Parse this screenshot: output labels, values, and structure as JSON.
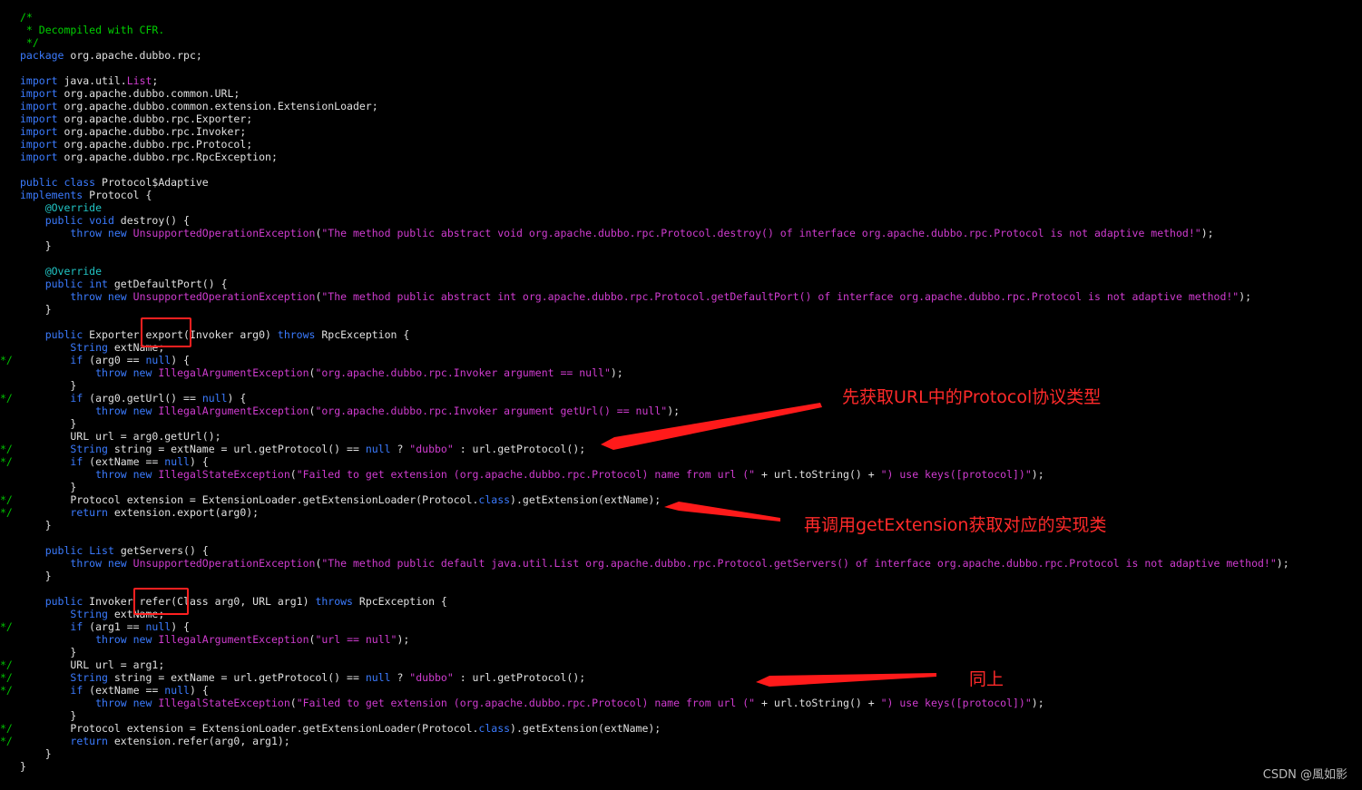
{
  "colors": {
    "background": "#000000",
    "comment": "#00d000",
    "keyword": "#3b7bff",
    "string": "#d03cd0",
    "annotation": "#21c4c4",
    "plain": "#e0e0e0",
    "annotation_red": "#ff2020"
  },
  "code_lines": [
    {
      "g": "",
      "s": [
        [
          "c",
          "/*"
        ]
      ]
    },
    {
      "g": "",
      "s": [
        [
          "c",
          " * Decompiled with CFR."
        ]
      ]
    },
    {
      "g": "",
      "s": [
        [
          "c",
          " */"
        ]
      ]
    },
    {
      "g": "",
      "s": [
        [
          "k",
          "package"
        ],
        [
          "p",
          " org.apache.dubbo.rpc;"
        ]
      ]
    },
    {
      "g": "",
      "s": []
    },
    {
      "g": "",
      "s": [
        [
          "k",
          "import"
        ],
        [
          "p",
          " java.util."
        ],
        [
          "s",
          "List"
        ],
        [
          "p",
          ";"
        ]
      ]
    },
    {
      "g": "",
      "s": [
        [
          "k",
          "import"
        ],
        [
          "p",
          " org.apache.dubbo.common.URL;"
        ]
      ]
    },
    {
      "g": "",
      "s": [
        [
          "k",
          "import"
        ],
        [
          "p",
          " org.apache.dubbo.common.extension.ExtensionLoader;"
        ]
      ]
    },
    {
      "g": "",
      "s": [
        [
          "k",
          "import"
        ],
        [
          "p",
          " org.apache.dubbo.rpc.Exporter;"
        ]
      ]
    },
    {
      "g": "",
      "s": [
        [
          "k",
          "import"
        ],
        [
          "p",
          " org.apache.dubbo.rpc.Invoker;"
        ]
      ]
    },
    {
      "g": "",
      "s": [
        [
          "k",
          "import"
        ],
        [
          "p",
          " org.apache.dubbo.rpc.Protocol;"
        ]
      ]
    },
    {
      "g": "",
      "s": [
        [
          "k",
          "import"
        ],
        [
          "p",
          " org.apache.dubbo.rpc.RpcException;"
        ]
      ]
    },
    {
      "g": "",
      "s": []
    },
    {
      "g": "",
      "s": [
        [
          "k",
          "public class"
        ],
        [
          "p",
          " Protocol$Adaptive"
        ]
      ]
    },
    {
      "g": "",
      "s": [
        [
          "k",
          "implements"
        ],
        [
          "p",
          " Protocol {"
        ]
      ]
    },
    {
      "g": "",
      "s": [
        [
          "p",
          "    "
        ],
        [
          "a",
          "@Override"
        ]
      ]
    },
    {
      "g": "",
      "s": [
        [
          "p",
          "    "
        ],
        [
          "k",
          "public void"
        ],
        [
          "p",
          " destroy() {"
        ]
      ]
    },
    {
      "g": "",
      "s": [
        [
          "p",
          "        "
        ],
        [
          "k",
          "throw new"
        ],
        [
          "p",
          " "
        ],
        [
          "s",
          "UnsupportedOperationException"
        ],
        [
          "p",
          "("
        ],
        [
          "s",
          "\"The method public abstract void org.apache.dubbo.rpc.Protocol.destroy() of interface org.apache.dubbo.rpc.Protocol is not adaptive method!\""
        ],
        [
          "p",
          ");"
        ]
      ]
    },
    {
      "g": "",
      "s": [
        [
          "p",
          "    }"
        ]
      ]
    },
    {
      "g": "",
      "s": []
    },
    {
      "g": "",
      "s": [
        [
          "p",
          "    "
        ],
        [
          "a",
          "@Override"
        ]
      ]
    },
    {
      "g": "",
      "s": [
        [
          "p",
          "    "
        ],
        [
          "k",
          "public int"
        ],
        [
          "p",
          " getDefaultPort() {"
        ]
      ]
    },
    {
      "g": "",
      "s": [
        [
          "p",
          "        "
        ],
        [
          "k",
          "throw new"
        ],
        [
          "p",
          " "
        ],
        [
          "s",
          "UnsupportedOperationException"
        ],
        [
          "p",
          "("
        ],
        [
          "s",
          "\"The method public abstract int org.apache.dubbo.rpc.Protocol.getDefaultPort() of interface org.apache.dubbo.rpc.Protocol is not adaptive method!\""
        ],
        [
          "p",
          ");"
        ]
      ]
    },
    {
      "g": "",
      "s": [
        [
          "p",
          "    }"
        ]
      ]
    },
    {
      "g": "",
      "s": []
    },
    {
      "g": "",
      "s": [
        [
          "p",
          "    "
        ],
        [
          "k",
          "public"
        ],
        [
          "p",
          " Exporter export(Invoker arg0) "
        ],
        [
          "k",
          "throws"
        ],
        [
          "p",
          " RpcException {"
        ]
      ]
    },
    {
      "g": "",
      "s": [
        [
          "p",
          "        "
        ],
        [
          "k",
          "String"
        ],
        [
          "p",
          " extName;"
        ]
      ]
    },
    {
      "g": "*/",
      "s": [
        [
          "p",
          "        "
        ],
        [
          "k",
          "if"
        ],
        [
          "p",
          " (arg0 == "
        ],
        [
          "k",
          "null"
        ],
        [
          "p",
          ") {"
        ]
      ]
    },
    {
      "g": "",
      "s": [
        [
          "p",
          "            "
        ],
        [
          "k",
          "throw new"
        ],
        [
          "p",
          " "
        ],
        [
          "s",
          "IllegalArgumentException"
        ],
        [
          "p",
          "("
        ],
        [
          "s",
          "\"org.apache.dubbo.rpc.Invoker argument == null\""
        ],
        [
          "p",
          ");"
        ]
      ]
    },
    {
      "g": "",
      "s": [
        [
          "p",
          "        }"
        ]
      ]
    },
    {
      "g": "*/",
      "s": [
        [
          "p",
          "        "
        ],
        [
          "k",
          "if"
        ],
        [
          "p",
          " (arg0.getUrl() == "
        ],
        [
          "k",
          "null"
        ],
        [
          "p",
          ") {"
        ]
      ]
    },
    {
      "g": "",
      "s": [
        [
          "p",
          "            "
        ],
        [
          "k",
          "throw new"
        ],
        [
          "p",
          " "
        ],
        [
          "s",
          "IllegalArgumentException"
        ],
        [
          "p",
          "("
        ],
        [
          "s",
          "\"org.apache.dubbo.rpc.Invoker argument getUrl() == null\""
        ],
        [
          "p",
          ");"
        ]
      ]
    },
    {
      "g": "",
      "s": [
        [
          "p",
          "        }"
        ]
      ]
    },
    {
      "g": "",
      "s": [
        [
          "p",
          "        URL url = arg0.getUrl();"
        ]
      ]
    },
    {
      "g": "*/",
      "s": [
        [
          "p",
          "        "
        ],
        [
          "k",
          "String"
        ],
        [
          "p",
          " string = extName = url.getProtocol() == "
        ],
        [
          "k",
          "null"
        ],
        [
          "p",
          " ? "
        ],
        [
          "s",
          "\"dubbo\""
        ],
        [
          "p",
          " : url.getProtocol();"
        ]
      ]
    },
    {
      "g": "*/",
      "s": [
        [
          "p",
          "        "
        ],
        [
          "k",
          "if"
        ],
        [
          "p",
          " (extName == "
        ],
        [
          "k",
          "null"
        ],
        [
          "p",
          ") {"
        ]
      ]
    },
    {
      "g": "",
      "s": [
        [
          "p",
          "            "
        ],
        [
          "k",
          "throw new"
        ],
        [
          "p",
          " "
        ],
        [
          "s",
          "IllegalStateException"
        ],
        [
          "p",
          "("
        ],
        [
          "s",
          "\"Failed to get extension (org.apache.dubbo.rpc.Protocol) name from url (\""
        ],
        [
          "p",
          " + url.toString() + "
        ],
        [
          "s",
          "\") use keys([protocol])\""
        ],
        [
          "p",
          ");"
        ]
      ]
    },
    {
      "g": "",
      "s": [
        [
          "p",
          "        }"
        ]
      ]
    },
    {
      "g": "*/",
      "s": [
        [
          "p",
          "        Protocol extension = ExtensionLoader.getExtensionLoader(Protocol."
        ],
        [
          "k",
          "class"
        ],
        [
          "p",
          ").getExtension(extName);"
        ]
      ]
    },
    {
      "g": "*/",
      "s": [
        [
          "p",
          "        "
        ],
        [
          "k",
          "return"
        ],
        [
          "p",
          " extension.export(arg0);"
        ]
      ]
    },
    {
      "g": "",
      "s": [
        [
          "p",
          "    }"
        ]
      ]
    },
    {
      "g": "",
      "s": []
    },
    {
      "g": "",
      "s": [
        [
          "p",
          "    "
        ],
        [
          "k",
          "public"
        ],
        [
          "p",
          " "
        ],
        [
          "k",
          "List"
        ],
        [
          "p",
          " getServers() {"
        ]
      ]
    },
    {
      "g": "",
      "s": [
        [
          "p",
          "        "
        ],
        [
          "k",
          "throw new"
        ],
        [
          "p",
          " "
        ],
        [
          "s",
          "UnsupportedOperationException"
        ],
        [
          "p",
          "("
        ],
        [
          "s",
          "\"The method public default java.util.List org.apache.dubbo.rpc.Protocol.getServers() of interface org.apache.dubbo.rpc.Protocol is not adaptive method!\""
        ],
        [
          "p",
          ");"
        ]
      ]
    },
    {
      "g": "",
      "s": [
        [
          "p",
          "    }"
        ]
      ]
    },
    {
      "g": "",
      "s": []
    },
    {
      "g": "",
      "s": [
        [
          "p",
          "    "
        ],
        [
          "k",
          "public"
        ],
        [
          "p",
          " Invoker refer(Class arg0, URL arg1) "
        ],
        [
          "k",
          "throws"
        ],
        [
          "p",
          " RpcException {"
        ]
      ]
    },
    {
      "g": "",
      "s": [
        [
          "p",
          "        "
        ],
        [
          "k",
          "String"
        ],
        [
          "p",
          " extName;"
        ]
      ]
    },
    {
      "g": "*/",
      "s": [
        [
          "p",
          "        "
        ],
        [
          "k",
          "if"
        ],
        [
          "p",
          " (arg1 == "
        ],
        [
          "k",
          "null"
        ],
        [
          "p",
          ") {"
        ]
      ]
    },
    {
      "g": "",
      "s": [
        [
          "p",
          "            "
        ],
        [
          "k",
          "throw new"
        ],
        [
          "p",
          " "
        ],
        [
          "s",
          "IllegalArgumentException"
        ],
        [
          "p",
          "("
        ],
        [
          "s",
          "\"url == null\""
        ],
        [
          "p",
          ");"
        ]
      ]
    },
    {
      "g": "",
      "s": [
        [
          "p",
          "        }"
        ]
      ]
    },
    {
      "g": "*/",
      "s": [
        [
          "p",
          "        URL url = arg1;"
        ]
      ]
    },
    {
      "g": "*/",
      "s": [
        [
          "p",
          "        "
        ],
        [
          "k",
          "String"
        ],
        [
          "p",
          " string = extName = url.getProtocol() == "
        ],
        [
          "k",
          "null"
        ],
        [
          "p",
          " ? "
        ],
        [
          "s",
          "\"dubbo\""
        ],
        [
          "p",
          " : url.getProtocol();"
        ]
      ]
    },
    {
      "g": "*/",
      "s": [
        [
          "p",
          "        "
        ],
        [
          "k",
          "if"
        ],
        [
          "p",
          " (extName == "
        ],
        [
          "k",
          "null"
        ],
        [
          "p",
          ") {"
        ]
      ]
    },
    {
      "g": "",
      "s": [
        [
          "p",
          "            "
        ],
        [
          "k",
          "throw new"
        ],
        [
          "p",
          " "
        ],
        [
          "s",
          "IllegalStateException"
        ],
        [
          "p",
          "("
        ],
        [
          "s",
          "\"Failed to get extension (org.apache.dubbo.rpc.Protocol) name from url (\""
        ],
        [
          "p",
          " + url.toString() + "
        ],
        [
          "s",
          "\") use keys([protocol])\""
        ],
        [
          "p",
          ");"
        ]
      ]
    },
    {
      "g": "",
      "s": [
        [
          "p",
          "        }"
        ]
      ]
    },
    {
      "g": "*/",
      "s": [
        [
          "p",
          "        Protocol extension = ExtensionLoader.getExtensionLoader(Protocol."
        ],
        [
          "k",
          "class"
        ],
        [
          "p",
          ").getExtension(extName);"
        ]
      ]
    },
    {
      "g": "*/",
      "s": [
        [
          "p",
          "        "
        ],
        [
          "k",
          "return"
        ],
        [
          "p",
          " extension.refer(arg0, arg1);"
        ]
      ]
    },
    {
      "g": "",
      "s": [
        [
          "p",
          "    }"
        ]
      ]
    },
    {
      "g": "",
      "s": [
        [
          "p",
          "}"
        ]
      ]
    }
  ],
  "annotations": {
    "note_protocol": "先获取URL中的Protocol协议类型",
    "note_get_extension": "再调用getExtension获取对应的实现类",
    "note_same": "同上"
  },
  "watermark": "CSDN @風如影"
}
